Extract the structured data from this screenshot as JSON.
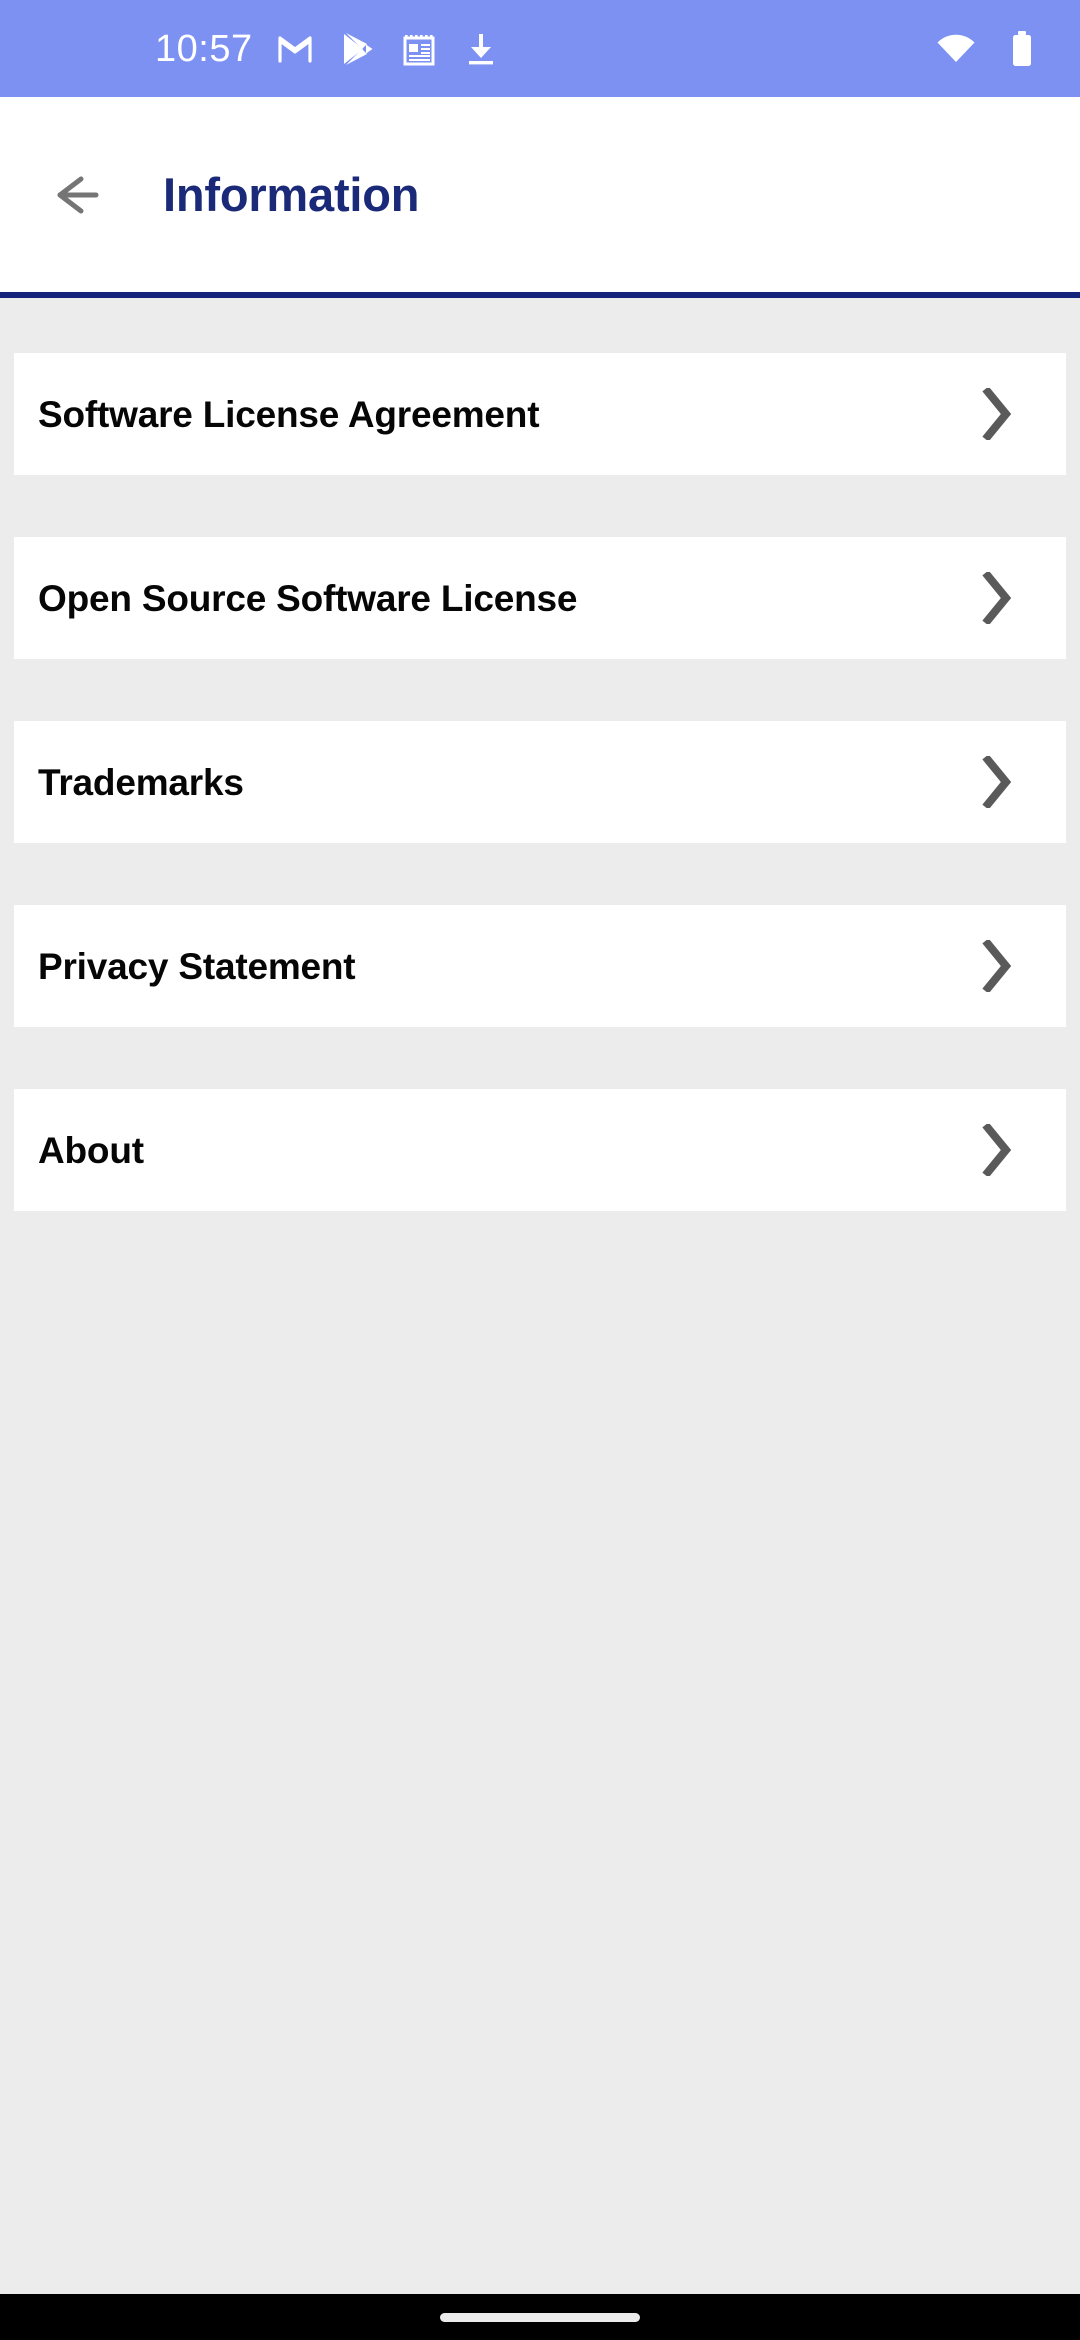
{
  "status_bar": {
    "time": "10:57",
    "background_color": "#7d91f2",
    "icon_color": "#ffffff",
    "notification_icons": [
      {
        "name": "gmail-icon",
        "label": "Gmail"
      },
      {
        "name": "google-play-icon",
        "label": "Google Play"
      },
      {
        "name": "news-icon",
        "label": "News"
      },
      {
        "name": "download-icon",
        "label": "Download"
      }
    ],
    "system_icons": [
      {
        "name": "wifi-icon",
        "label": "Wi-Fi"
      },
      {
        "name": "battery-icon",
        "label": "Battery"
      }
    ]
  },
  "app_bar": {
    "title": "Information",
    "back_label": "Back",
    "title_color": "#1b2a78",
    "divider_color": "#13247a",
    "background_color": "#ffffff"
  },
  "screen": {
    "background_color": "#ececec",
    "card_color": "#ffffff",
    "chevron_color": "#5a5a5a"
  },
  "list": {
    "items": [
      {
        "label": "Software License Agreement"
      },
      {
        "label": "Open Source Software License"
      },
      {
        "label": "Trademarks"
      },
      {
        "label": "Privacy Statement"
      },
      {
        "label": "About"
      }
    ]
  },
  "nav_bar": {
    "background_color": "#000000",
    "gesture_pill_color": "#ebebeb"
  }
}
